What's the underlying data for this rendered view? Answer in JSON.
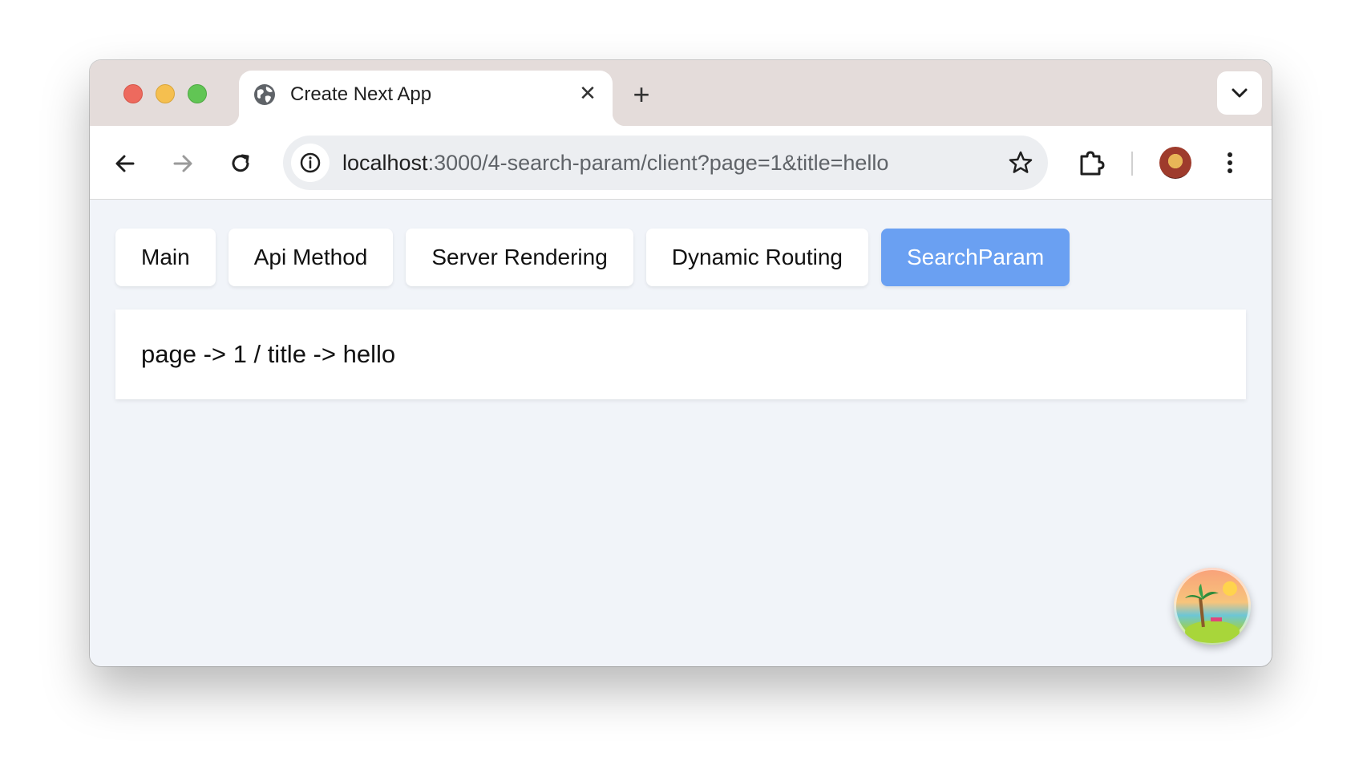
{
  "window": {
    "tab": {
      "title": "Create Next App",
      "close_glyph": "✕",
      "favicon": "globe-icon"
    },
    "new_tab_glyph": "+",
    "toolbar": {
      "url_host": "localhost",
      "url_rest": ":3000/4-search-param/client?page=1&title=hello"
    }
  },
  "page": {
    "nav": [
      {
        "label": "Main",
        "active": false
      },
      {
        "label": "Api Method",
        "active": false
      },
      {
        "label": "Server Rendering",
        "active": false
      },
      {
        "label": "Dynamic Routing",
        "active": false
      },
      {
        "label": "SearchParam",
        "active": true
      }
    ],
    "result_text": "page -> 1 / title -> hello"
  },
  "colors": {
    "active_nav": "#6aa0f2",
    "page_bg": "#f1f4f9",
    "tabstrip_bg": "#e4dcda"
  }
}
